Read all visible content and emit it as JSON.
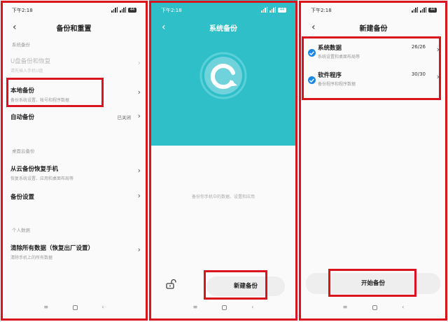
{
  "status": {
    "time": "下午2:18",
    "battery": "44"
  },
  "screen1": {
    "title": "备份和重置",
    "section_system": "系统备份",
    "udisk": {
      "title": "U盘备份和恢复",
      "subtitle": "请先插入手机U盘"
    },
    "local": {
      "title": "本地备份",
      "subtitle": "备份系统设置、帐号和程序数据"
    },
    "auto": {
      "title": "自动备份",
      "value": "已关闭"
    },
    "section_cloud": "桌面云备份",
    "restore": {
      "title": "从云备份恢复手机",
      "subtitle": "恢复系统设置、应用和桌面布局等"
    },
    "settings": {
      "title": "备份设置"
    },
    "section_personal": "个人数据",
    "erase": {
      "title": "清除所有数据（恢复出厂设置）",
      "subtitle": "清除手机上的所有数据"
    }
  },
  "screen2": {
    "title": "系统备份",
    "description": "备份你手机中的数据、设置和应用",
    "new_backup_button": "新建备份"
  },
  "screen3": {
    "title": "新建备份",
    "items": [
      {
        "title": "系统数据",
        "subtitle": "系统设置和桌面布局等",
        "count": "26/26"
      },
      {
        "title": "软件程序",
        "subtitle": "备份程序和程序数据",
        "count": "30/30"
      }
    ],
    "start_button": "开始备份"
  },
  "colors": {
    "accent": "#2fbfc9",
    "highlight": "#d9141c",
    "check": "#1e86e5"
  },
  "icons": {
    "back": "back-arrow-icon",
    "chevron": "chevron-right-icon",
    "menu": "menu-icon",
    "home": "home-icon",
    "nav_back": "nav-back-icon",
    "lock": "unlock-icon",
    "logo": "backup-logo-icon",
    "check": "checkmark-icon"
  }
}
